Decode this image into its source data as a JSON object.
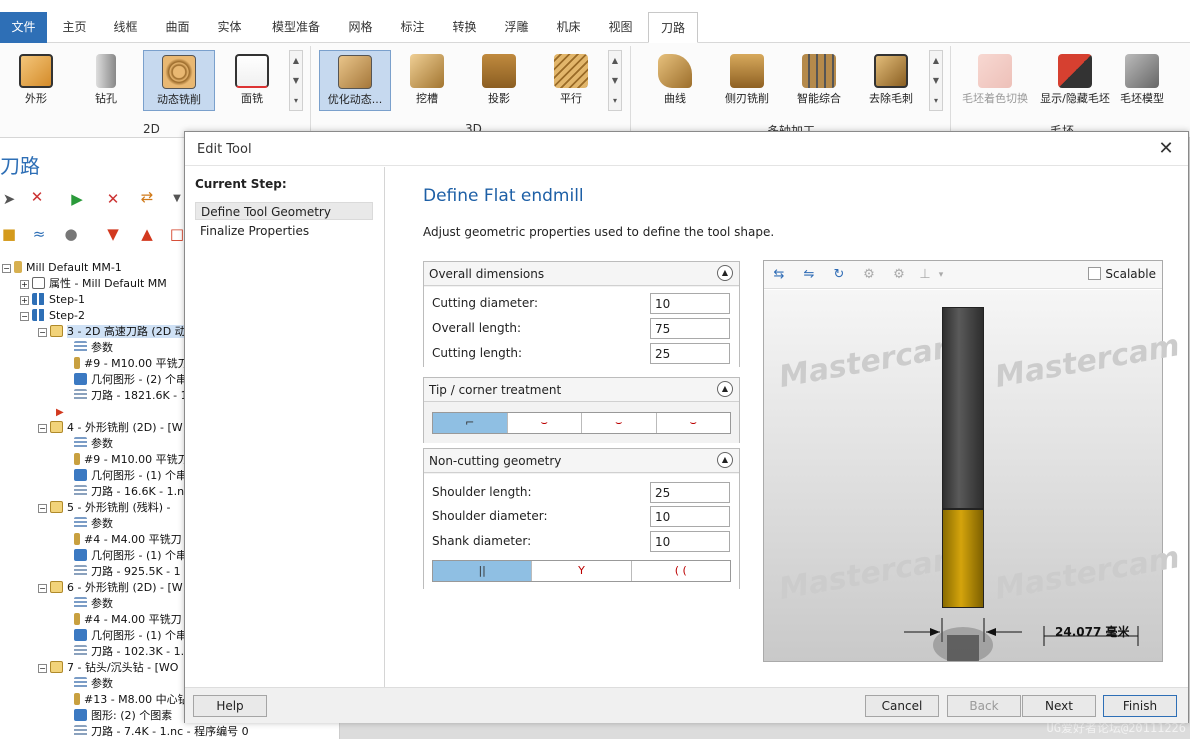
{
  "menubar": {
    "file": "文件",
    "tabs": [
      "主页",
      "线框",
      "曲面",
      "实体",
      "模型准备",
      "网格",
      "标注",
      "转换",
      "浮雕",
      "机床",
      "视图",
      "刀路"
    ]
  },
  "ribbon": {
    "buttons_2d": [
      "外形",
      "钻孔",
      "动态铣削",
      "面铣"
    ],
    "buttons_3d": [
      "优化动态...",
      "挖槽",
      "投影",
      "平行"
    ],
    "buttons_multi": [
      "曲线",
      "侧刃铣削",
      "智能综合",
      "去除毛刺"
    ],
    "buttons_stock": [
      "毛坯着色切换",
      "显示/隐藏毛坯",
      "毛坯模型"
    ],
    "group_2d": "2D",
    "group_3d": "3D",
    "group_multi": "多轴加工",
    "group_stock": "毛坯"
  },
  "tree": {
    "title": "刀路",
    "rows": [
      "Mill Default MM-1",
      "属性 - Mill Default MM",
      "Step-1",
      "Step-2",
      "3 - 2D 高速刀路 (2D 动",
      "参数",
      "#9 - M10.00 平铣刀",
      "几何图形 - (2) 个串",
      "刀路 - 1821.6K - 1",
      "",
      "4 - 外形铣削 (2D) - [W",
      "参数",
      "#9 - M10.00 平铣刀",
      "几何图形 - (1) 个串",
      "刀路 - 16.6K - 1.nc",
      "5 - 外形铣削 (残料) -",
      "参数",
      "#4 - M4.00 平铣刀",
      "几何图形 - (1) 个串",
      "刀路 - 925.5K - 1",
      "6 - 外形铣削 (2D) - [W",
      "参数",
      "#4 - M4.00 平铣刀",
      "几何图形 - (1) 个串",
      "刀路 - 102.3K - 1.",
      "7 - 钻头/沉头钻 - [WO",
      "参数",
      "#13 - M8.00 中心钻",
      "图形: (2) 个图素",
      "刀路 - 7.4K - 1.nc - 程序编号 0"
    ]
  },
  "watermark": "UG爱好者论坛@20111226",
  "dialog": {
    "title": "Edit Tool",
    "current_step_label": "Current Step:",
    "steps": [
      "Define Tool Geometry",
      "Finalize Properties"
    ],
    "heading": "Define Flat endmill",
    "description": "Adjust geometric properties used to define the tool shape.",
    "overall": {
      "title": "Overall dimensions",
      "cutting_diameter_label": "Cutting diameter:",
      "cutting_diameter": "10",
      "overall_length_label": "Overall length:",
      "overall_length": "75",
      "cutting_length_label": "Cutting length:",
      "cutting_length": "25"
    },
    "tip": {
      "title": "Tip / corner treatment",
      "options": [
        "⌐",
        "⌣",
        "⌣",
        "⌣"
      ]
    },
    "noncut": {
      "title": "Non-cutting geometry",
      "shoulder_length_label": "Shoulder length:",
      "shoulder_length": "25",
      "shoulder_diameter_label": "Shoulder diameter:",
      "shoulder_diameter": "10",
      "shank_diameter_label": "Shank diameter:",
      "shank_diameter": "10",
      "options": [
        "||",
        "Y",
        "( ("
      ]
    },
    "preview": {
      "scalable_label": "Scalable",
      "watermark_text": "Mastercam",
      "dimension": "24.077 毫米"
    },
    "buttons": {
      "help": "Help",
      "cancel": "Cancel",
      "back": "Back",
      "next": "Next",
      "finish": "Finish"
    }
  }
}
